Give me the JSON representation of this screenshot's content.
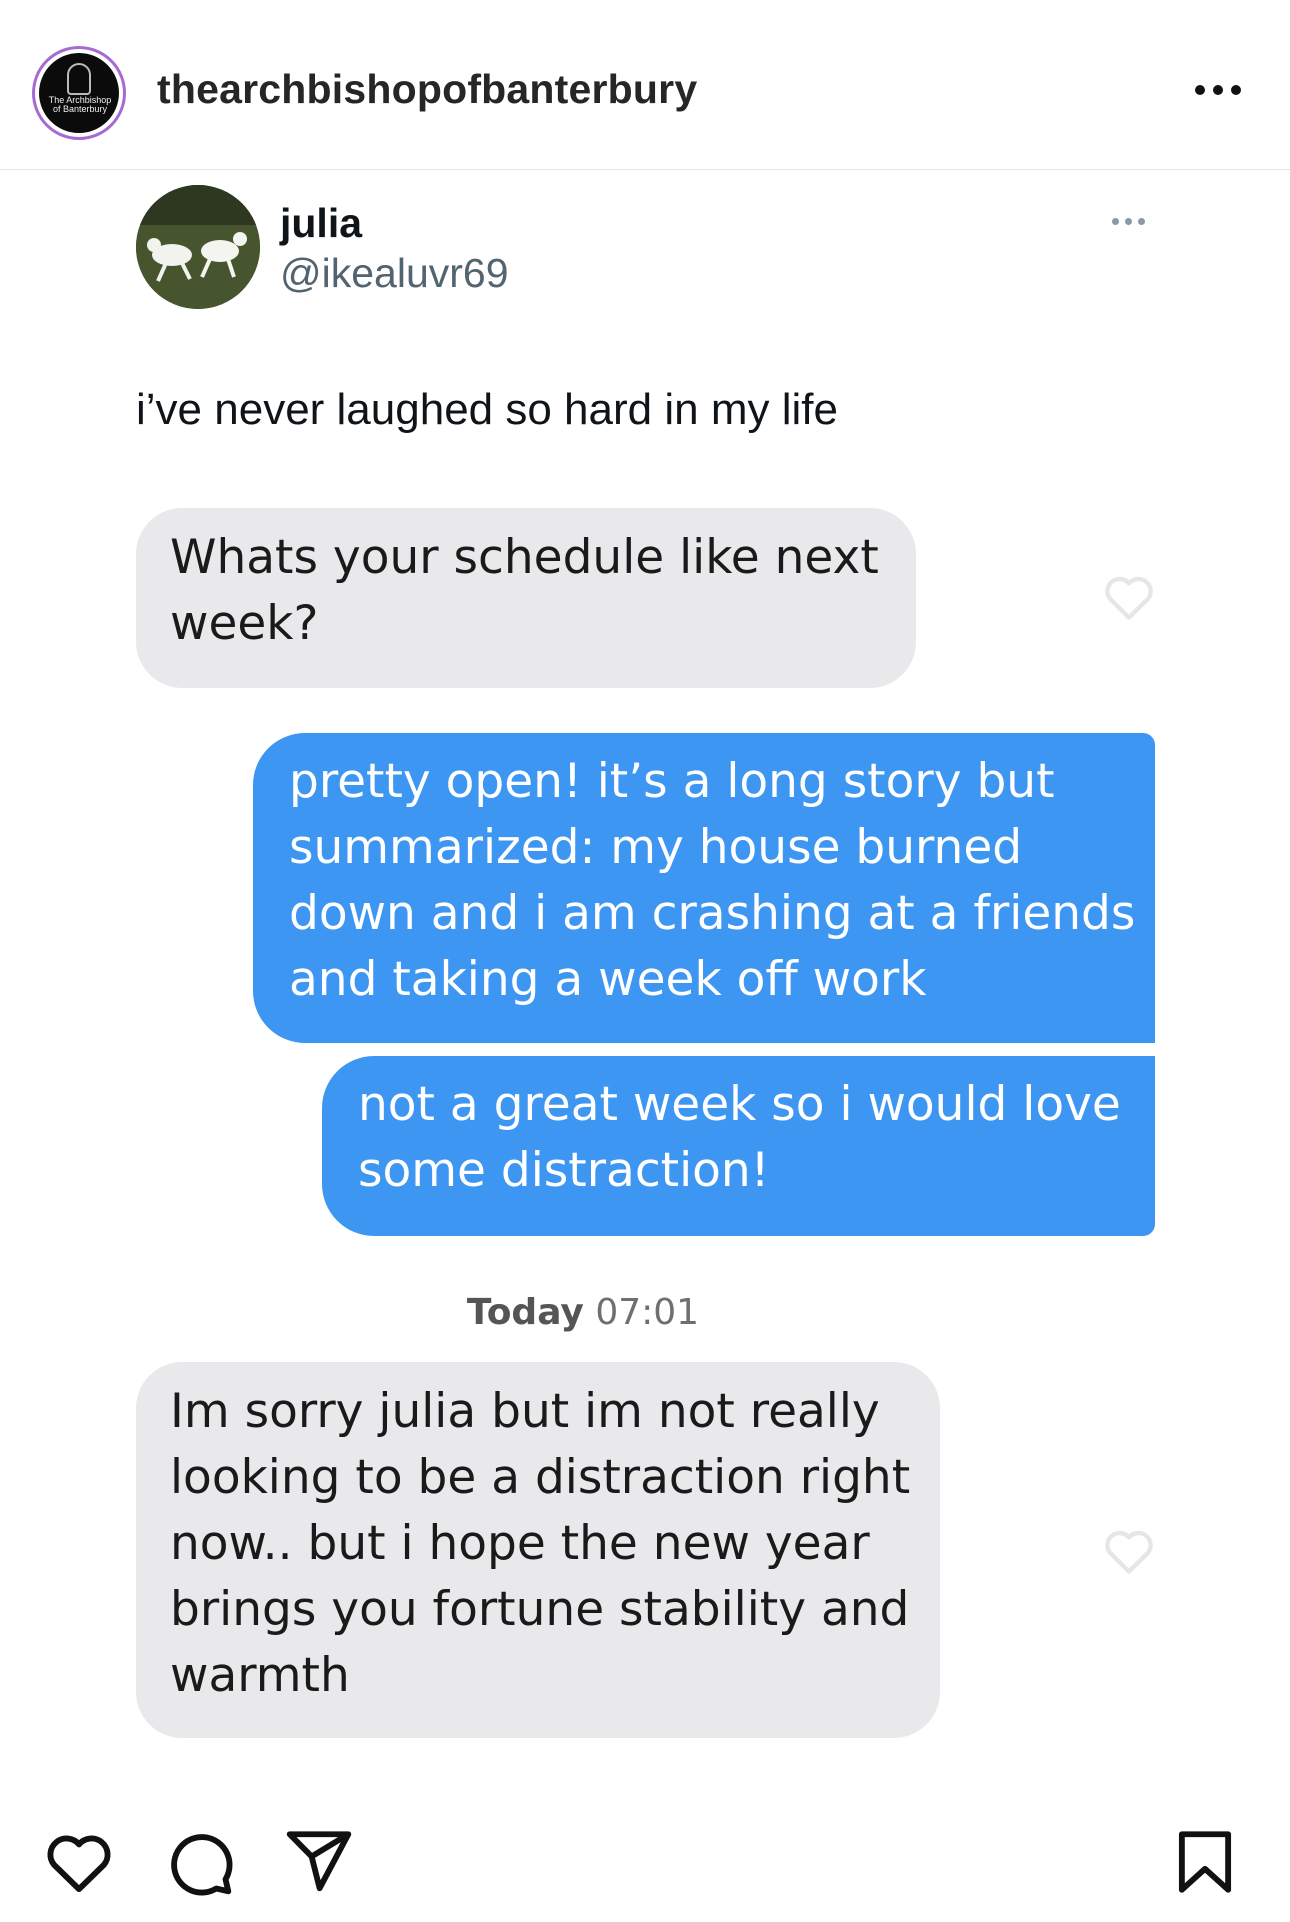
{
  "post": {
    "username": "thearchbishopofbanterbury",
    "avatar_text": "The Archbishop of Banterbury",
    "avatar_ring_color": "#a66bd3",
    "more_icon": "ellipsis-icon"
  },
  "tweet": {
    "name": "julia",
    "handle": "@ikealuvr69",
    "text": "i’ve never laughed so hard in my life",
    "more_icon": "ellipsis-icon"
  },
  "chat": {
    "incoming_color": "#e9e9eb",
    "outgoing_color": "#3d96f2",
    "messages": [
      {
        "from": "them",
        "lines": [
          "Whats your schedule like next",
          "week?"
        ]
      },
      {
        "from": "me",
        "lines": [
          "pretty open! it’s a long story but",
          "summarized: my house burned",
          "down and i am crashing at a friends",
          "and taking a week off work"
        ]
      },
      {
        "from": "me",
        "lines": [
          "not a great week so i would love",
          "some distraction!"
        ]
      },
      {
        "from": "them",
        "lines": [
          "Im sorry julia but im not really",
          "looking to be a distraction right",
          "now.. but i hope the new year",
          "brings you fortune stability and",
          "warmth"
        ]
      }
    ],
    "timestamp_day": "Today",
    "timestamp_time": "07:01",
    "heart_icon": "heart-outline-icon"
  },
  "actions": {
    "like_icon": "heart-icon",
    "comment_icon": "comment-icon",
    "share_icon": "paper-plane-icon",
    "save_icon": "bookmark-icon"
  }
}
